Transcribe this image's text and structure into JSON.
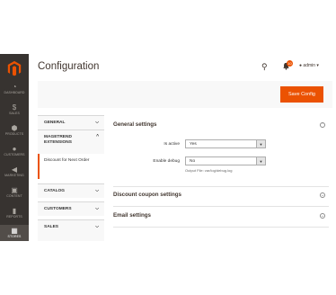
{
  "sidebar": {
    "items": [
      {
        "label": "DASHBOARD",
        "icon": "dashboard-icon"
      },
      {
        "label": "SALES",
        "icon": "dollar-icon"
      },
      {
        "label": "PRODUCTS",
        "icon": "box-icon"
      },
      {
        "label": "CUSTOMERS",
        "icon": "user-icon"
      },
      {
        "label": "MARKETING",
        "icon": "megaphone-icon"
      },
      {
        "label": "CONTENT",
        "icon": "layout-icon"
      },
      {
        "label": "REPORTS",
        "icon": "bar-chart-icon"
      },
      {
        "label": "STORES",
        "icon": "store-icon"
      }
    ]
  },
  "header": {
    "title": "Configuration",
    "notification_count": "10",
    "user": "admin ▾"
  },
  "actions": {
    "save_label": "Save Config"
  },
  "tabs": {
    "general": "GENERAL",
    "magetrend": "MAGETREND EXTENSIONS",
    "subitem": "Discount for Next Order",
    "catalog": "CATALOG",
    "customers": "CUSTOMERS",
    "sales": "SALES"
  },
  "main": {
    "general_settings": {
      "title": "General settings",
      "is_active_label": "Is active",
      "is_active_value": "Yes",
      "enable_debug_label": "Enable debug",
      "enable_debug_value": "No",
      "debug_note": "Output File: var/log/debug.log"
    },
    "discount_coupon_settings": "Discount coupon settings",
    "email_settings": "Email settings"
  },
  "colors": {
    "accent": "#eb5202",
    "sidebar": "#373330"
  }
}
